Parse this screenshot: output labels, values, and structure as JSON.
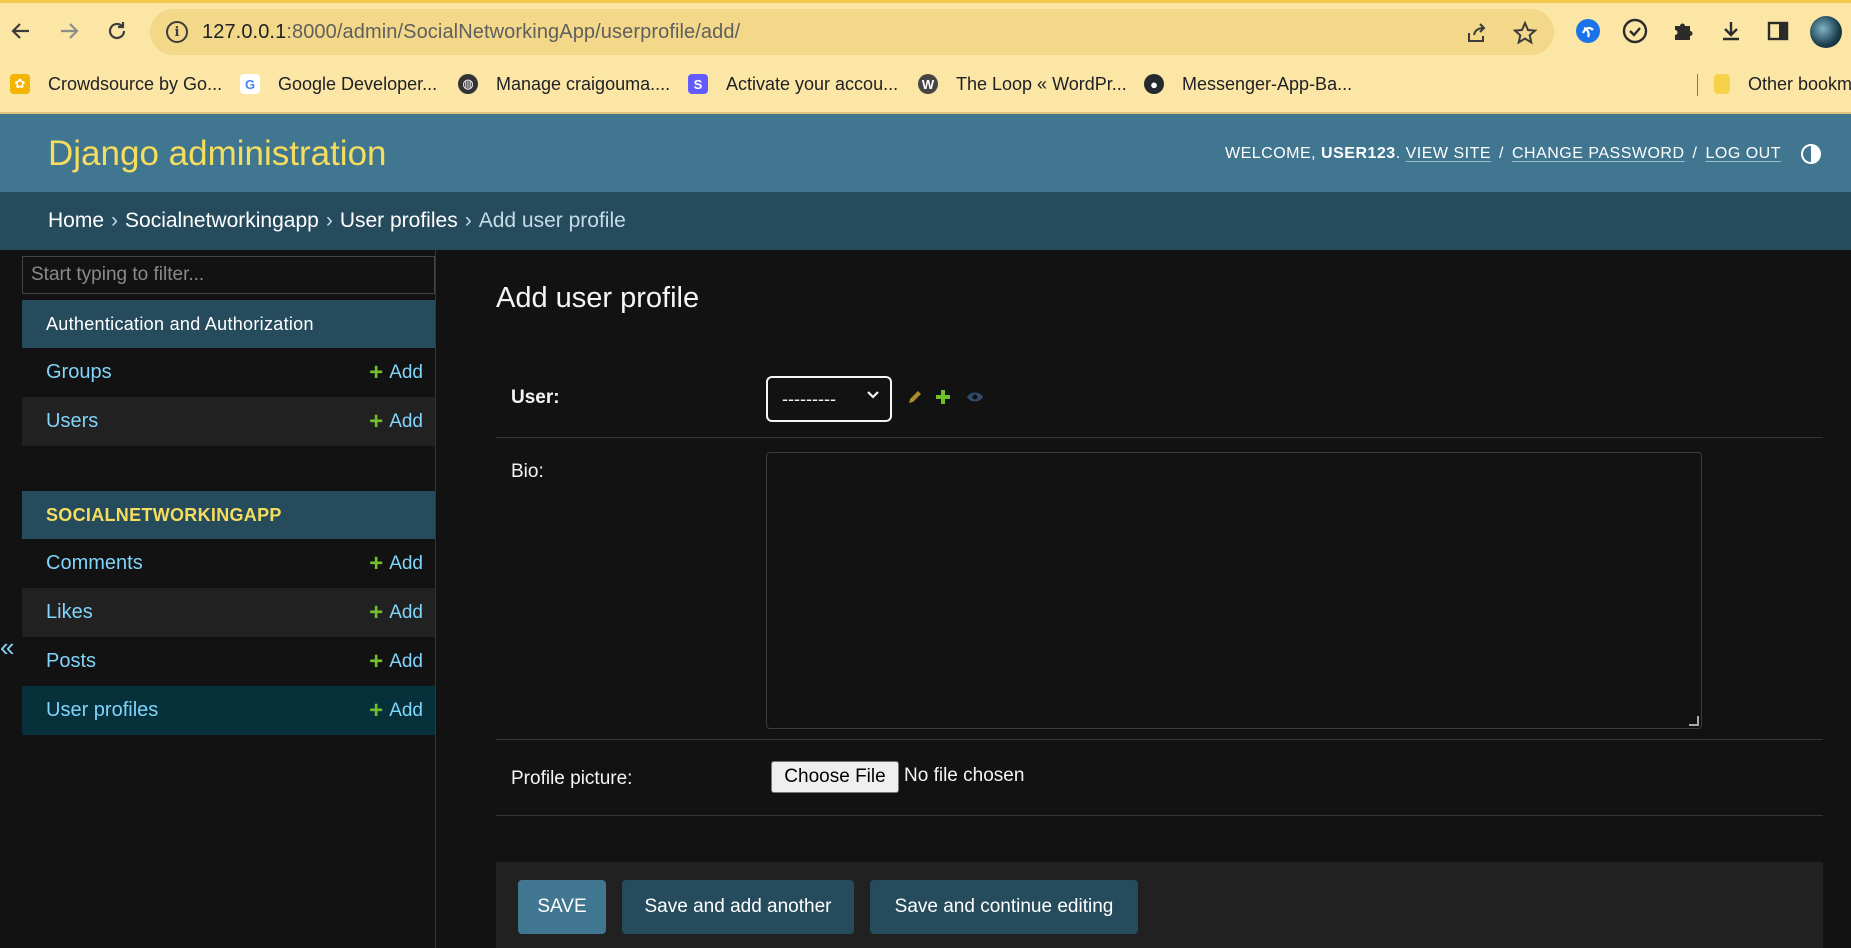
{
  "browser": {
    "url_host": "127.0.0.1",
    "url_rest": ":8000/admin/SocialNetworkingApp/userprofile/add/",
    "bookmarks": [
      {
        "label": "Crowdsource by Go...",
        "icon": "crowdsource-icon",
        "color": "#f4b400"
      },
      {
        "label": "Google Developer...",
        "icon": "google-icon",
        "color": "#4285f4"
      },
      {
        "label": "Manage craigouma....",
        "icon": "globe-icon",
        "color": "#333333"
      },
      {
        "label": "Activate your accou...",
        "icon": "stripe-icon",
        "color": "#635bff"
      },
      {
        "label": "The Loop « WordPr...",
        "icon": "wordpress-icon",
        "color": "#464646"
      },
      {
        "label": "Messenger-App-Ba...",
        "icon": "github-icon",
        "color": "#24292e"
      },
      {
        "label": "Other bookm",
        "icon": "folder-icon",
        "color": "#f6d24b"
      }
    ]
  },
  "header": {
    "branding": "Django administration",
    "welcome": "Welcome,",
    "username": "user123",
    "view_site": "View site",
    "change_password": "Change password",
    "log_out": "Log out"
  },
  "breadcrumbs": {
    "home": "Home",
    "app": "Socialnetworkingapp",
    "model": "User profiles",
    "current": "Add user profile"
  },
  "sidebar": {
    "filter_placeholder": "Start typing to filter...",
    "modules": [
      {
        "caption": "Authentication and Authorization",
        "models": [
          {
            "name": "Groups",
            "add": "Add"
          },
          {
            "name": "Users",
            "add": "Add"
          }
        ]
      },
      {
        "caption": "SOCIALNETWORKINGAPP",
        "models": [
          {
            "name": "Comments",
            "add": "Add"
          },
          {
            "name": "Likes",
            "add": "Add"
          },
          {
            "name": "Posts",
            "add": "Add"
          },
          {
            "name": "User profiles",
            "add": "Add"
          }
        ]
      }
    ],
    "collapse_glyph": "«"
  },
  "form": {
    "title": "Add user profile",
    "user_label": "User:",
    "user_value": "---------",
    "bio_label": "Bio:",
    "bio_value": "",
    "picture_label": "Profile picture:",
    "choose_file": "Choose File",
    "no_file": "No file chosen"
  },
  "submit": {
    "save": "SAVE",
    "save_add_another": "Save and add another",
    "save_continue": "Save and continue editing"
  },
  "colors": {
    "header_bg": "#417690",
    "breadcrumb_bg": "#264b5d",
    "branding": "#f5dd5d",
    "link": "#81d4fa",
    "add_plus": "#70bf2b",
    "page_bg": "#121212"
  }
}
